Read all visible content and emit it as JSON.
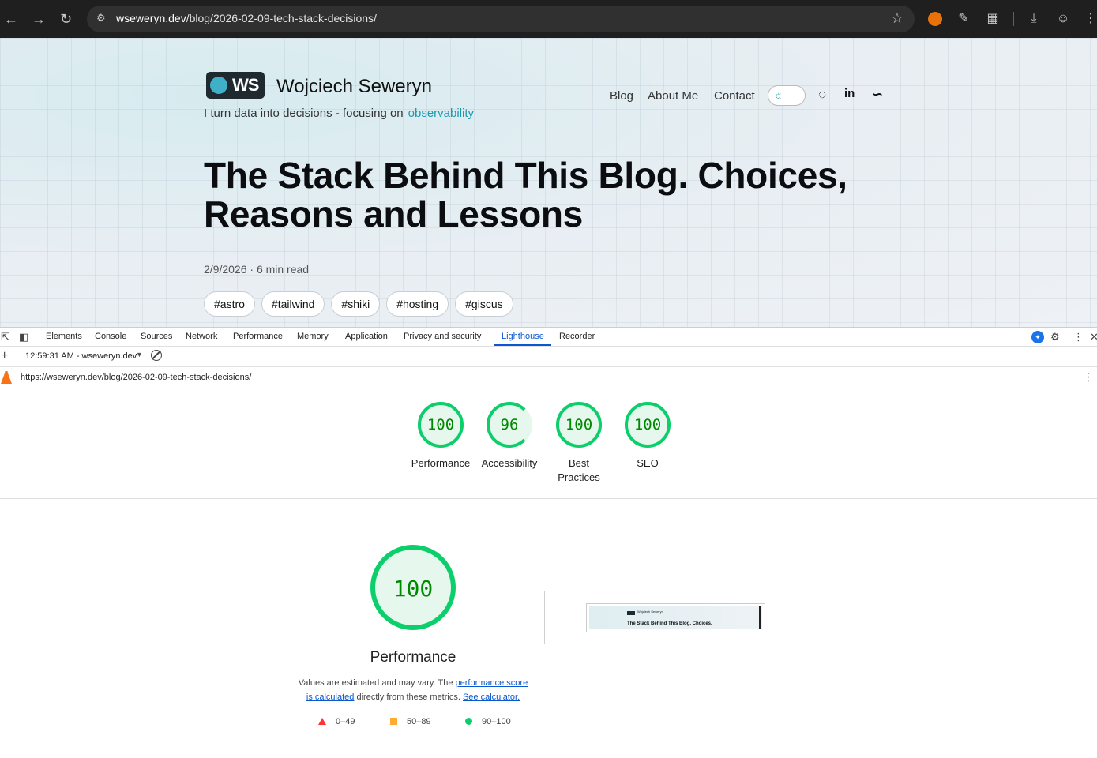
{
  "browser": {
    "url_host": "wseweryn.dev",
    "url_path": "/blog/2026-02-09-tech-stack-decisions/"
  },
  "blog": {
    "logo_text": "WS",
    "site_name": "Wojciech Seweryn",
    "tagline": "I turn data into decisions - focusing on",
    "tagline_highlight": "observability",
    "nav": [
      "Blog",
      "About Me",
      "Contact"
    ],
    "post_title": "The Stack Behind This Blog. Choices, Reasons and Lessons",
    "meta": "2/9/2026 · 6 min read",
    "tags": [
      "#astro",
      "#tailwind",
      "#shiki",
      "#hosting",
      "#giscus"
    ],
    "accent_color": "#1a9bb0"
  },
  "devtools": {
    "tabs": [
      "Elements",
      "Console",
      "Sources",
      "Network",
      "Performance",
      "Memory",
      "Application",
      "Privacy and security",
      "Lighthouse",
      "Recorder"
    ],
    "active_tab": "Lighthouse",
    "report_selector": "12:59:31 AM - wseweryn.dev",
    "report_url": "https://wseweryn.dev/blog/2026-02-09-tech-stack-decisions/"
  },
  "lighthouse": {
    "scores": [
      {
        "label": "Performance",
        "value": "100"
      },
      {
        "label": "Accessibility",
        "value": "96"
      },
      {
        "label": "Best Practices",
        "value": "100"
      },
      {
        "label": "SEO",
        "value": "100"
      }
    ],
    "main_score": "100",
    "main_title": "Performance",
    "note_prefix": "Values are estimated and may vary. The",
    "note_link1": "performance score is calculated",
    "note_mid": "directly from these metrics.",
    "note_link2": "See calculator.",
    "legend": [
      "0–49",
      "50–89",
      "90–100"
    ],
    "pass_color": "#0cce6b",
    "average_color": "#ffaa33",
    "fail_color": "#ff3333",
    "thumbnail_title": "The Stack Behind This Blog. Choices,",
    "thumbnail_site": "Wojciech Seweryn"
  }
}
